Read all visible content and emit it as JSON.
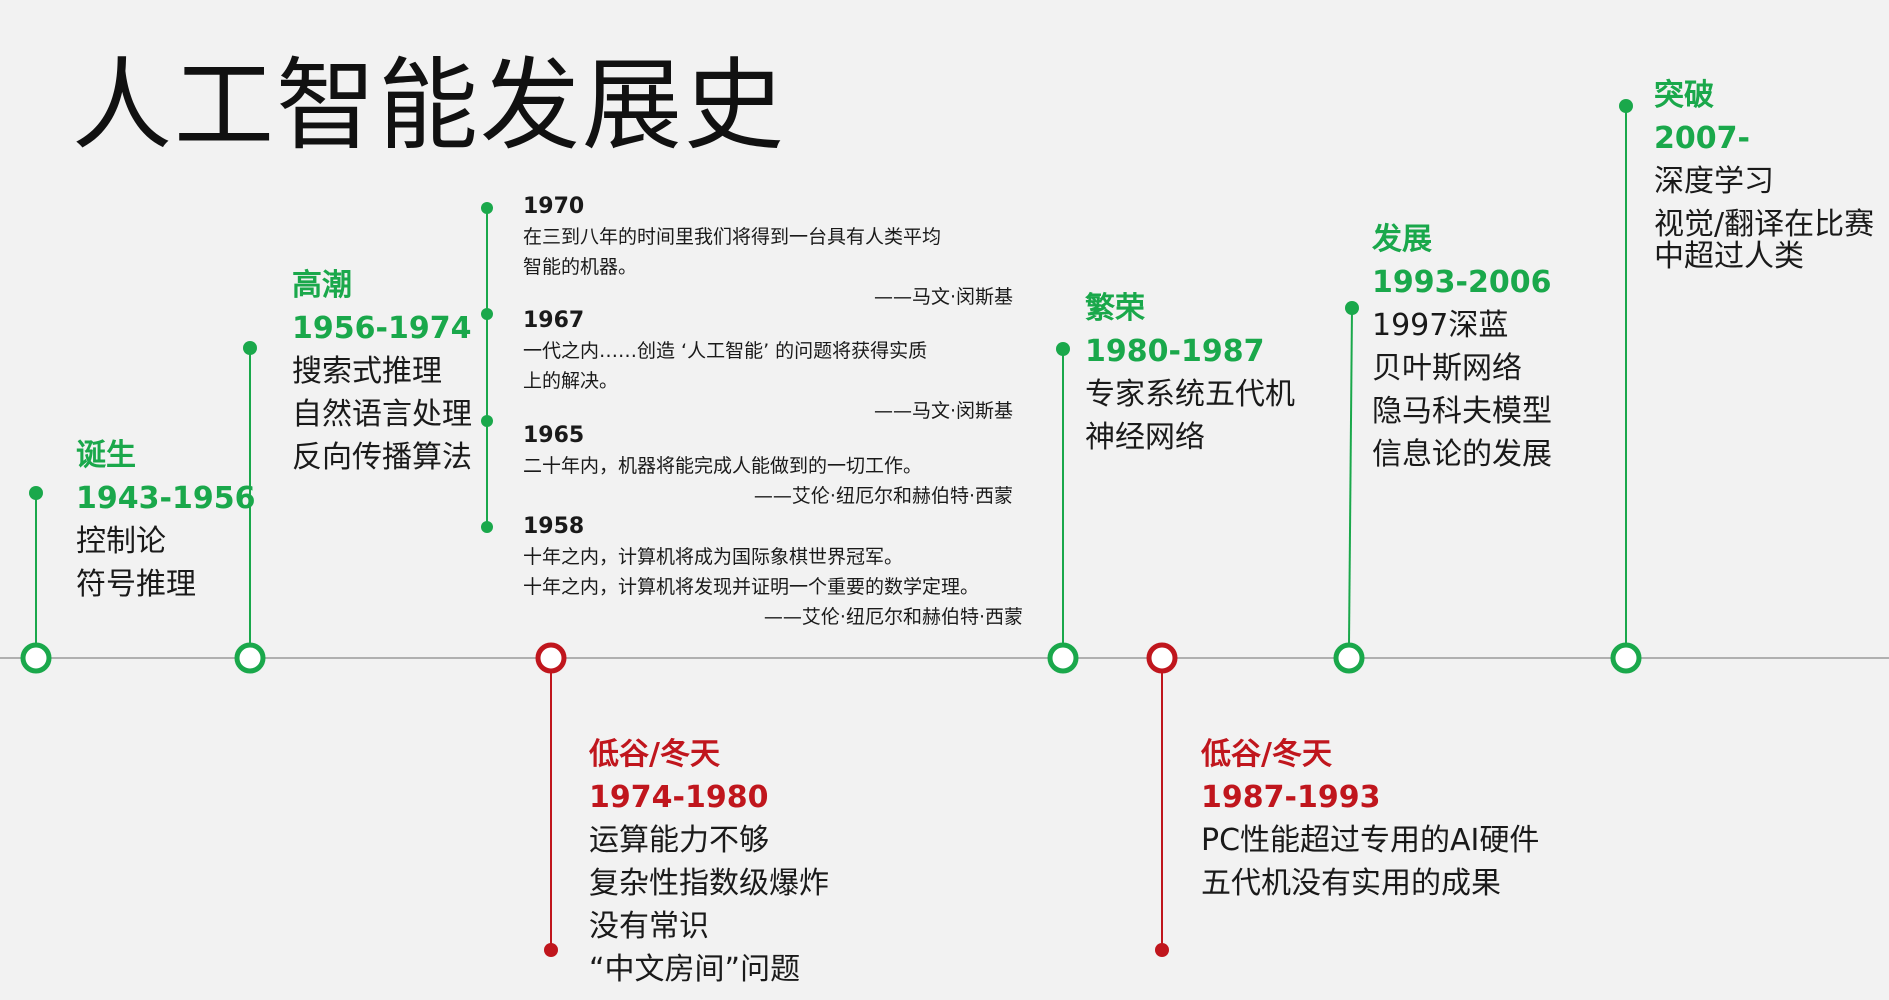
{
  "title": "人工智能发展史",
  "colors": {
    "green": "#1aa84b",
    "red": "#c0161d",
    "axis": "#9a9a9a",
    "background": "#f2f2f2"
  },
  "periods": [
    {
      "name": "诞生",
      "years": "1943-1956",
      "items": [
        "控制论",
        "符号推理"
      ],
      "color": "green"
    },
    {
      "name": "高潮",
      "years": "1956-1974",
      "items": [
        "搜索式推理",
        "自然语言处理",
        "反向传播算法"
      ],
      "color": "green"
    },
    {
      "name": "低谷/冬天",
      "years": "1974-1980",
      "items": [
        "运算能力不够",
        "复杂性指数级爆炸",
        "没有常识",
        "“中文房间”问题"
      ],
      "color": "red"
    },
    {
      "name": "繁荣",
      "years": "1980-1987",
      "items": [
        "专家系统五代机",
        "神经网络"
      ],
      "color": "green"
    },
    {
      "name": "低谷/冬天",
      "years": "1987-1993",
      "items": [
        "PC性能超过专用的AI硬件",
        "五代机没有实用的成果"
      ],
      "color": "red"
    },
    {
      "name": "发展",
      "years": "1993-2006",
      "items": [
        "1997深蓝",
        "贝叶斯网络",
        "隐马科夫模型",
        "信息论的发展"
      ],
      "color": "green"
    },
    {
      "name": "突破",
      "years": "2007-",
      "items": [
        "深度学习",
        "视觉/翻译在比赛",
        "中超过人类"
      ],
      "color": "green"
    }
  ],
  "quotes": [
    {
      "year": "1970",
      "lines": [
        "在三到八年的时间里我们将得到一台具有人类平均",
        "智能的机器。"
      ],
      "author": "——马文·闵斯基"
    },
    {
      "year": "1967",
      "lines": [
        "一代之内……创造 ‘人工智能’ 的问题将获得实质",
        "上的解决。"
      ],
      "author": "——马文·闵斯基"
    },
    {
      "year": "1965",
      "lines": [
        "二十年内，机器将能完成人能做到的一切工作。"
      ],
      "author": "——艾伦·纽厄尔和赫伯特·西蒙"
    },
    {
      "year": "1958",
      "lines": [
        "十年之内，计算机将成为国际象棋世界冠军。",
        "十年之内，计算机将发现并证明一个重要的数学定理。"
      ],
      "author": "——艾伦·纽厄尔和赫伯特·西蒙"
    }
  ]
}
